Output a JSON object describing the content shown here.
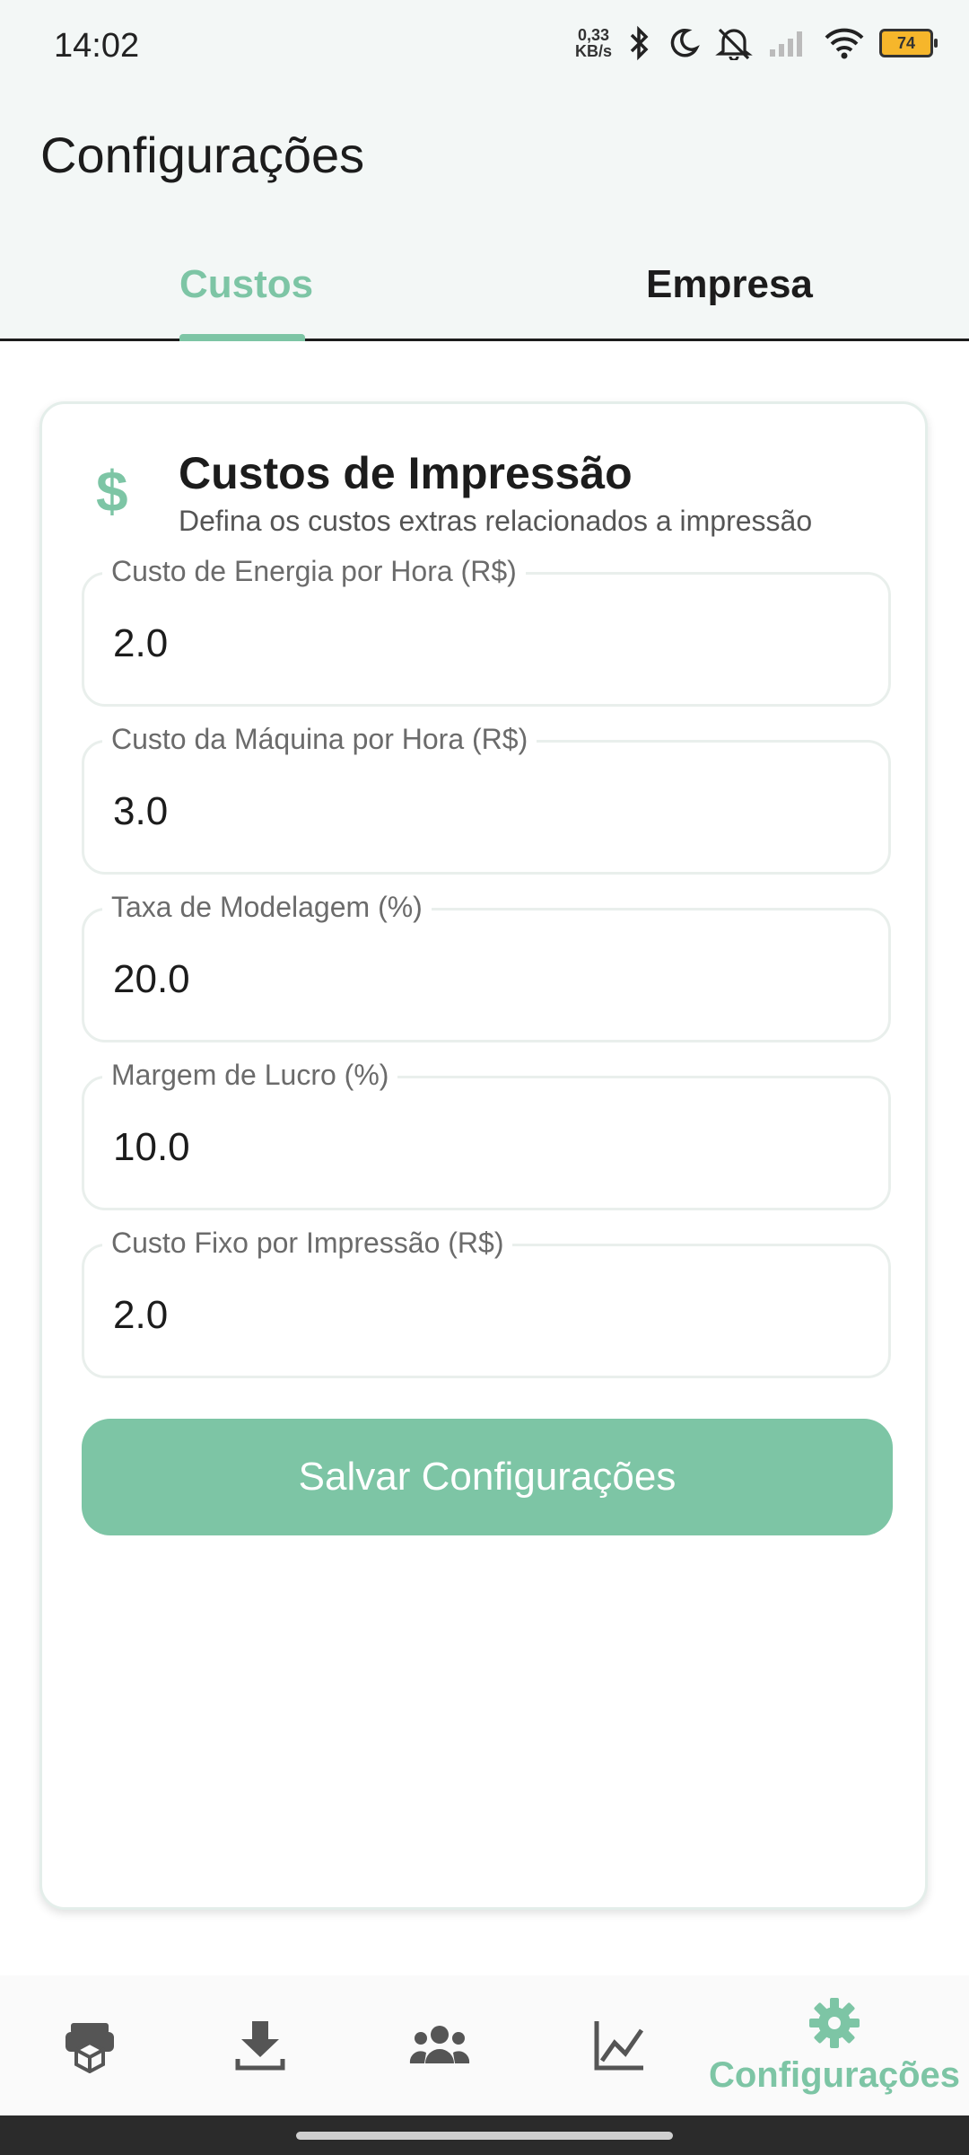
{
  "status_bar": {
    "time": "14:02",
    "net_speed_value": "0,33",
    "net_speed_unit": "KB/s",
    "battery": "74",
    "icons": [
      "bluetooth-icon",
      "moon-icon",
      "bell-off-icon",
      "signal-icon",
      "wifi-icon",
      "battery-icon"
    ]
  },
  "header": {
    "title": "Configurações",
    "tabs": [
      {
        "label": "Custos",
        "active": true
      },
      {
        "label": "Empresa",
        "active": false
      }
    ]
  },
  "card": {
    "icon": "$",
    "title": "Custos de Impressão",
    "subtitle": "Defina os custos extras relacionados a impressão",
    "fields": [
      {
        "label": "Custo de Energia por Hora (R$)",
        "value": "2.0"
      },
      {
        "label": "Custo da Máquina por Hora (R$)",
        "value": "3.0"
      },
      {
        "label": "Taxa de Modelagem (%)",
        "value": "20.0"
      },
      {
        "label": "Margem de Lucro (%)",
        "value": "10.0"
      },
      {
        "label": "Custo Fixo por Impressão (R$)",
        "value": "2.0"
      }
    ],
    "save_label": "Salvar Configurações"
  },
  "bottom_nav": {
    "items": [
      {
        "icon": "printer-box-icon"
      },
      {
        "icon": "download-icon"
      },
      {
        "icon": "users-icon"
      },
      {
        "icon": "chart-icon"
      },
      {
        "icon": "gear-icon",
        "label": "Configurações",
        "active": true
      }
    ]
  },
  "colors": {
    "accent": "#7dc5a5",
    "header_bg": "#f3f7f6",
    "text": "#1c1c1c"
  }
}
